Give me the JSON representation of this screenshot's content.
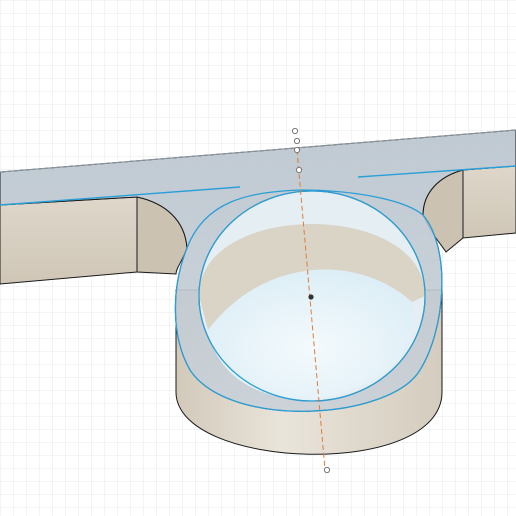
{
  "viewport": {
    "name": "3d-modeling-canvas",
    "background": "#ffffff",
    "grid_color": "#d9dde2",
    "grid_major_color": "#c6cbd1"
  },
  "model": {
    "body_color": "#e6e0d5",
    "body_shadow_color": "#cfc6b7",
    "top_face_color": "#c9d2da",
    "selection_color": "#2a9fd6",
    "hole_color": "#eaf5fb",
    "edge_color": "#1a1a1a",
    "axis_color": "#e07b3a"
  }
}
